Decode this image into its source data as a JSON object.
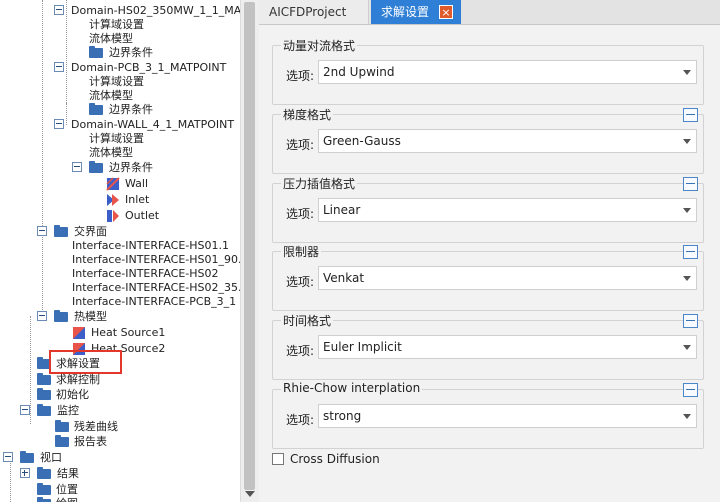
{
  "tree": {
    "domain_hs02": "Domain-HS02_350MW_1_1_MA...",
    "compute_domain": "计算域设置",
    "fluid_model": "流体模型",
    "boundary_conditions": "边界条件",
    "domain_pcb": "Domain-PCB_3_1_MATPOINT",
    "domain_wall": "Domain-WALL_4_1_MATPOINT",
    "wall": "Wall",
    "inlet": "Inlet",
    "outlet": "Outlet",
    "interfaces": "交界面",
    "interface_items": [
      "Interface-INTERFACE-HS01.1",
      "Interface-INTERFACE-HS01_90...",
      "Interface-INTERFACE-HS02",
      "Interface-INTERFACE-HS02_35...",
      "Interface-INTERFACE-PCB_3_1"
    ],
    "heat_model": "热模型",
    "heat_source1": "Heat Source1",
    "heat_source2": "Heat Source2",
    "solver_settings": "求解设置",
    "solver_control": "求解控制",
    "initialization": "初始化",
    "monitor": "监控",
    "residual_curve": "残差曲线",
    "report_table": "报告表",
    "viewport": "视口",
    "results": "结果",
    "position": "位置",
    "plot": "绘图"
  },
  "tabs": {
    "project": "AICFDProject",
    "solver": "求解设置",
    "close": "×"
  },
  "option_label": "选项:",
  "groups": [
    {
      "title": "动量对流格式",
      "value": "2nd Upwind"
    },
    {
      "title": "梯度格式",
      "value": "Green-Gauss"
    },
    {
      "title": "压力插值格式",
      "value": "Linear"
    },
    {
      "title": "限制器",
      "value": "Venkat"
    },
    {
      "title": "时间格式",
      "value": "Euler Implicit"
    },
    {
      "title": "Rhie-Chow interplation",
      "value": "strong"
    }
  ],
  "cross_diffusion": {
    "label": "Cross Diffusion",
    "checked": false
  },
  "colors": {
    "accent": "#2f7fd6",
    "highlight": "#e2372b",
    "folder": "#3a6fb5"
  }
}
